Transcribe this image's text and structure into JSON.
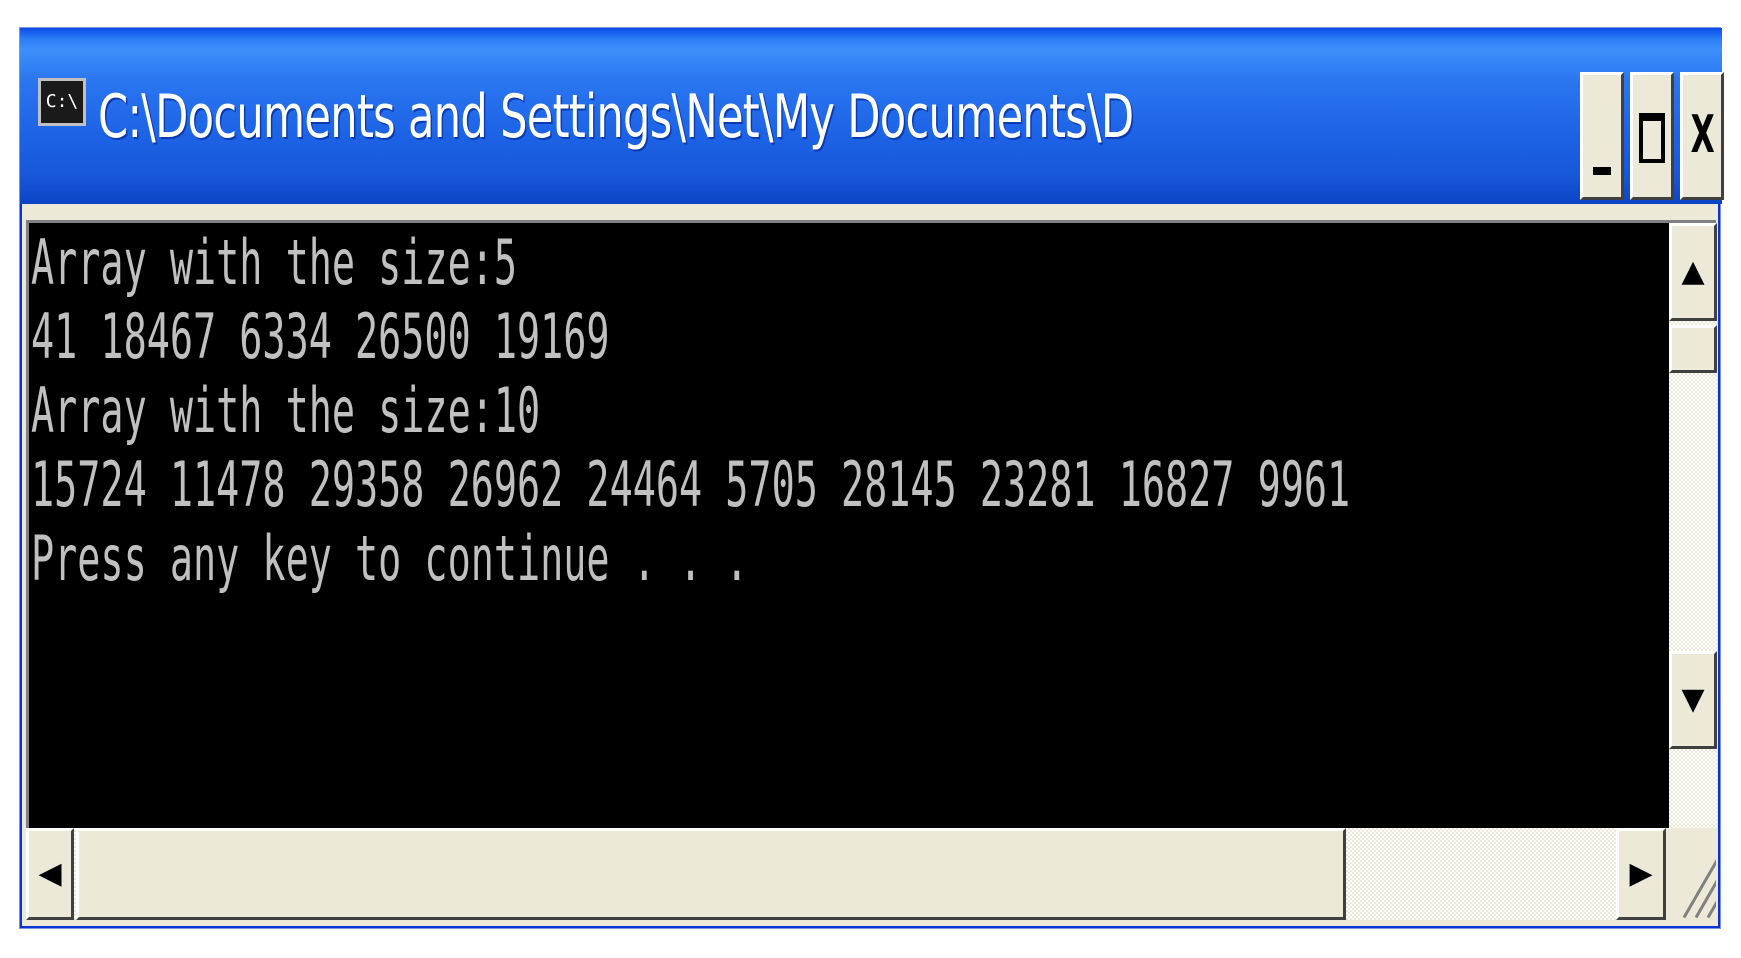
{
  "window": {
    "title": "C:\\Documents and Settings\\Net\\My Documents\\Decuong\\ProgrammingTe...",
    "icon_label": "C:\\",
    "icon": "console-app-icon"
  },
  "controls": {
    "minimize_icon": "minimize-icon",
    "maximize_icon": "maximize-icon",
    "close_label": "X"
  },
  "console": {
    "lines": [
      "Array with the size:5",
      "41 18467 6334 26500 19169",
      "Array with the size:10",
      "15724 11478 29358 26962 24464 5705 28145 23281 16827 9961",
      "Press any key to continue . . ."
    ],
    "text_color": "#c0c0c0",
    "background": "#000000"
  },
  "scrollbars": {
    "up_arrow": "▲",
    "down_arrow": "▼",
    "left_arrow": "◀",
    "right_arrow": "▶"
  },
  "colors": {
    "titlebar": "#1d63e6",
    "chrome": "#ece9d8"
  }
}
